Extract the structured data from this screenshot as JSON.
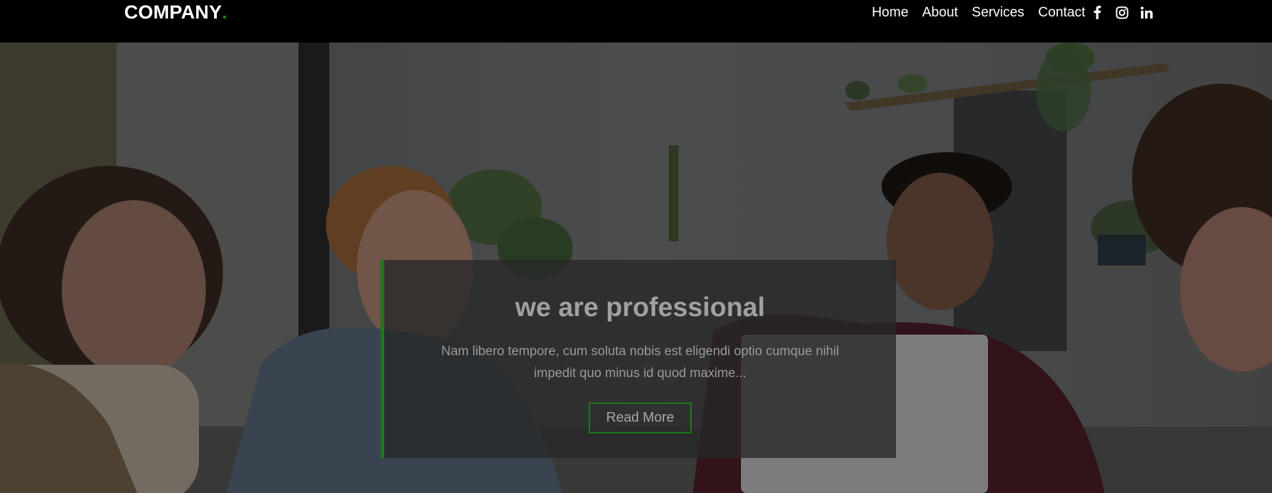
{
  "header": {
    "logo_text": "COMPANY",
    "logo_dot": ".",
    "nav": [
      {
        "label": "Home"
      },
      {
        "label": "About"
      },
      {
        "label": "Services"
      },
      {
        "label": "Contact"
      }
    ],
    "social_icons": [
      "facebook-icon",
      "instagram-icon",
      "linkedin-icon"
    ]
  },
  "hero": {
    "title": "we are professional",
    "text": "Nam libero tempore, cum soluta nobis est eligendi optio cumque nihil impedit quo minus id quod maxime...",
    "button_label": "Read More"
  },
  "colors": {
    "accent": "#1c7a1c",
    "header_bg": "#000000",
    "card_bg": "rgba(40,40,40,0.78)"
  }
}
